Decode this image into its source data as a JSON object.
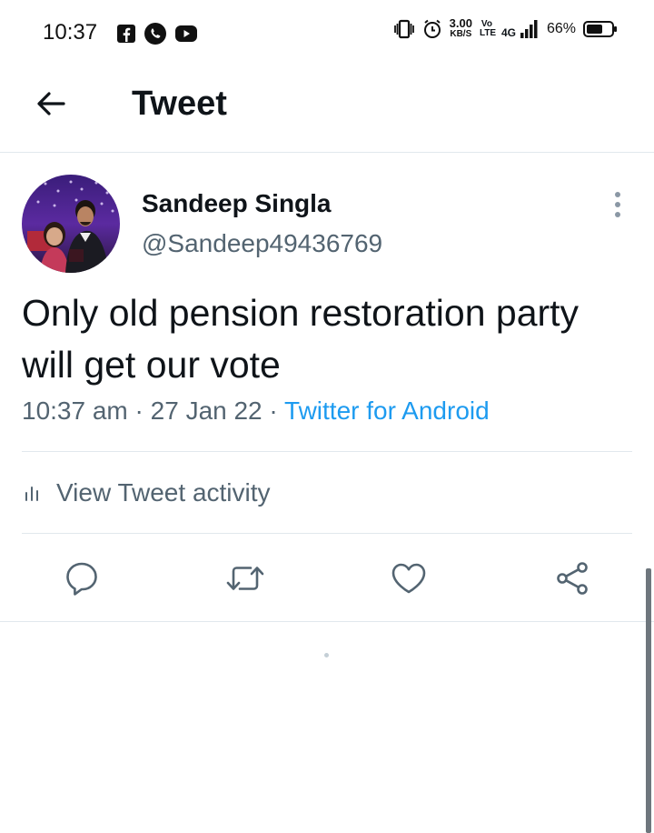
{
  "status_bar": {
    "time": "10:37",
    "speed_value": "3.00",
    "speed_unit": "KB/S",
    "network": "4G",
    "volte": "Vo LTE",
    "battery_percent": "66%",
    "battery_level": 0.66,
    "left_icons": [
      "facebook-icon",
      "whatsapp-icon",
      "youtube-icon"
    ],
    "right_icons": [
      "vibrate-icon",
      "alarm-icon",
      "signal-icon",
      "battery-icon"
    ]
  },
  "header": {
    "title": "Tweet"
  },
  "tweet": {
    "author_name": "Sandeep Singla",
    "author_handle": "@Sandeep49436769",
    "text": "Only old pension restoration party will get our vote",
    "time": "10:37 am",
    "separator": "·",
    "date": "27 Jan 22",
    "source": "Twitter for Android"
  },
  "activity": {
    "label": "View Tweet activity"
  },
  "actions": [
    "reply-icon",
    "retweet-icon",
    "like-icon",
    "share-icon"
  ],
  "colors": {
    "accent": "#1d9bf0",
    "secondary_text": "#536471",
    "divider": "#e1e8ed"
  }
}
